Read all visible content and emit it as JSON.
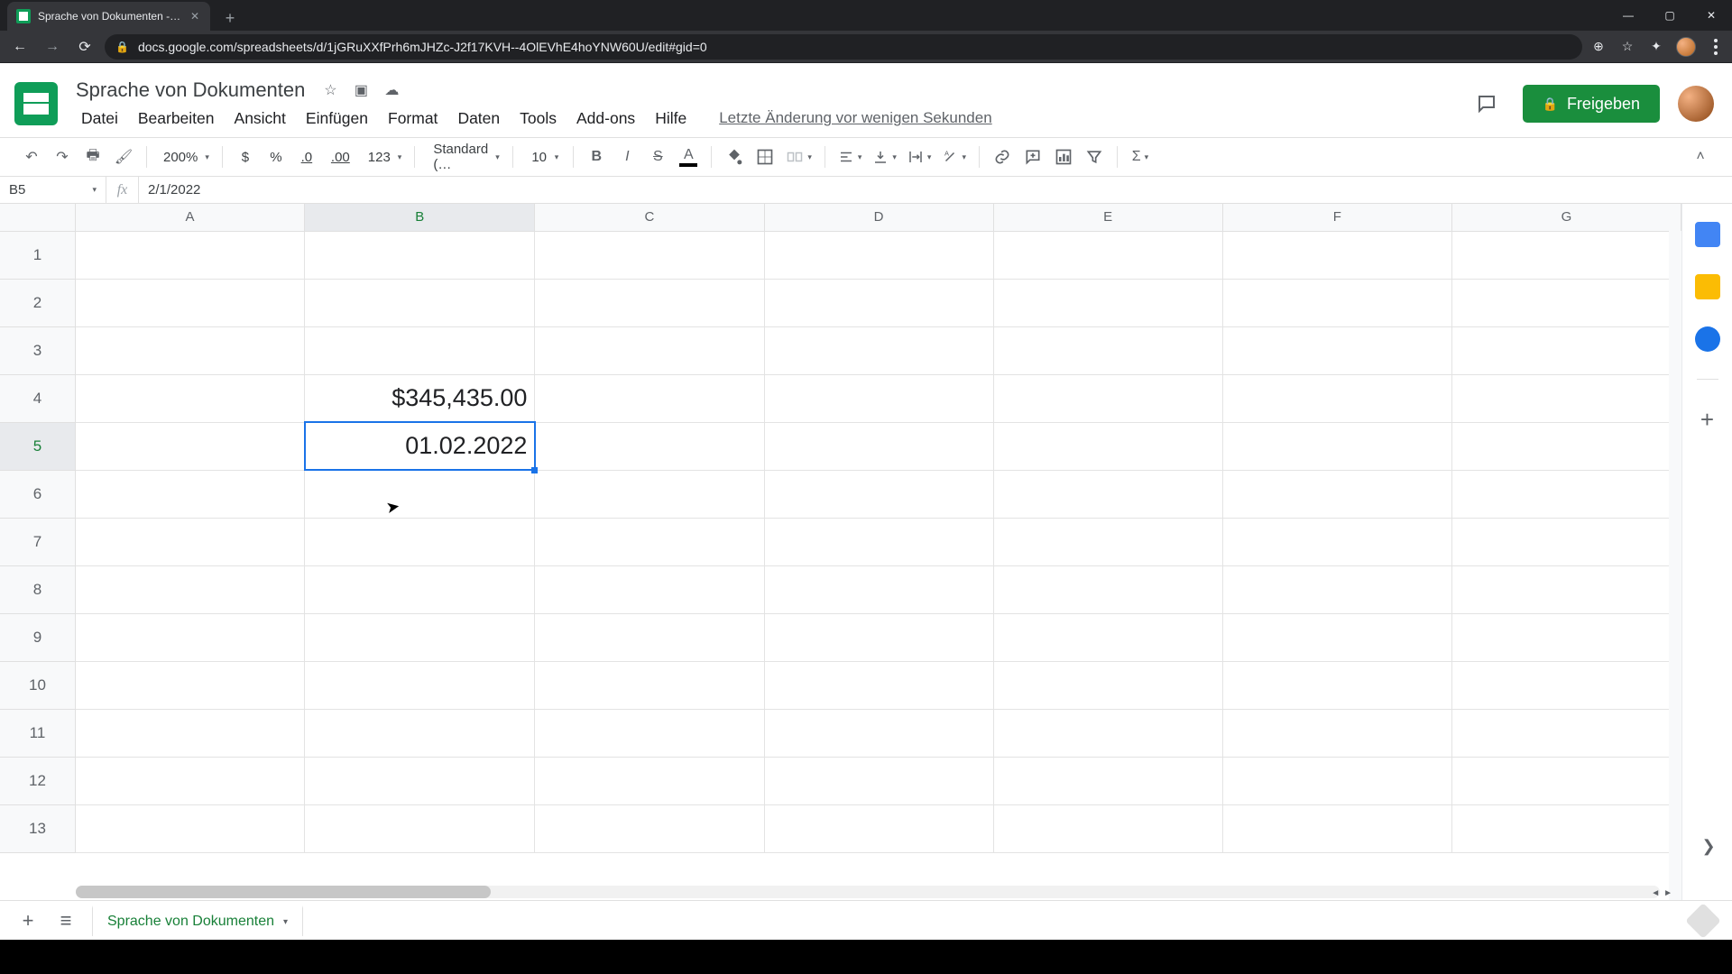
{
  "browser": {
    "tab_title": "Sprache von Dokumenten - Goo…",
    "url": "docs.google.com/spreadsheets/d/1jGRuXXfPrh6mJHZc-J2f17KVH--4OlEVhE4hoYNW60U/edit#gid=0"
  },
  "doc": {
    "title": "Sprache von Dokumenten",
    "last_edit": "Letzte Änderung vor wenigen Sekunden"
  },
  "menus": {
    "file": "Datei",
    "edit": "Bearbeiten",
    "view": "Ansicht",
    "insert": "Einfügen",
    "format": "Format",
    "data": "Daten",
    "tools": "Tools",
    "addons": "Add-ons",
    "help": "Hilfe"
  },
  "share": {
    "label": "Freigeben"
  },
  "toolbar": {
    "zoom": "200%",
    "currency": "$",
    "percent": "%",
    "dec_dec": ".0",
    "inc_dec": ".00",
    "numfmt": "123",
    "fontfmt": "Standard (…",
    "fontsize": "10"
  },
  "namebox": {
    "ref": "B5"
  },
  "formula": {
    "value": "2/1/2022"
  },
  "columns": [
    "A",
    "B",
    "C",
    "D",
    "E",
    "F",
    "G"
  ],
  "rows": [
    "1",
    "2",
    "3",
    "4",
    "5",
    "6",
    "7",
    "8",
    "9",
    "10",
    "11",
    "12",
    "13"
  ],
  "cells": {
    "B4": "$345,435.00",
    "B5": "01.02.2022"
  },
  "active": {
    "col": "B",
    "row": "5"
  },
  "sheet_tab": {
    "name": "Sprache von Dokumenten"
  }
}
